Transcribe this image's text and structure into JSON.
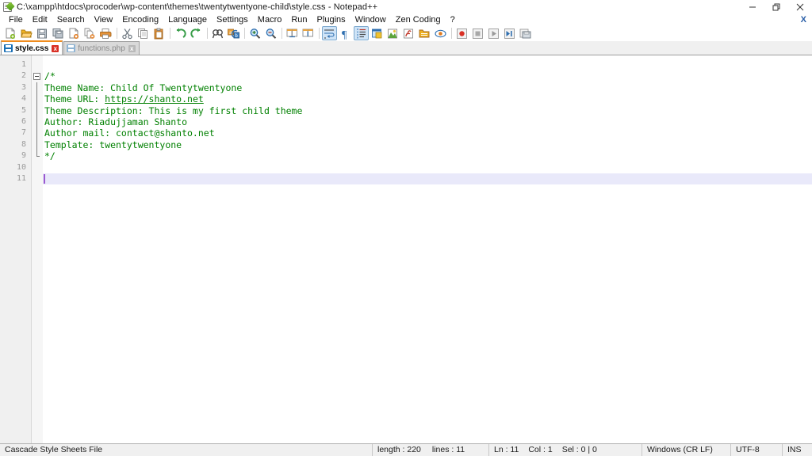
{
  "window": {
    "title": "C:\\xampp\\htdocs\\procoder\\wp-content\\themes\\twentytwentyone-child\\style.css - Notepad++",
    "icon": "notepad-plus-plus-icon",
    "controls": {
      "minimize": "minimize-icon",
      "restore": "restore-icon",
      "close": "close-icon"
    }
  },
  "menubar": {
    "items": [
      {
        "label": "File"
      },
      {
        "label": "Edit"
      },
      {
        "label": "Search"
      },
      {
        "label": "View"
      },
      {
        "label": "Encoding"
      },
      {
        "label": "Language"
      },
      {
        "label": "Settings"
      },
      {
        "label": "Macro"
      },
      {
        "label": "Run"
      },
      {
        "label": "Plugins"
      },
      {
        "label": "Window"
      },
      {
        "label": "Zen Coding"
      },
      {
        "label": "?"
      }
    ],
    "doc_close_label": "X"
  },
  "toolbar": {
    "buttons": [
      {
        "name": "new-file-icon",
        "group": 1
      },
      {
        "name": "open-file-icon",
        "group": 1
      },
      {
        "name": "save-icon",
        "group": 1
      },
      {
        "name": "save-all-icon",
        "group": 1
      },
      {
        "name": "close-file-icon",
        "group": 1
      },
      {
        "name": "close-all-files-icon",
        "group": 1
      },
      {
        "name": "print-icon",
        "group": 1
      },
      {
        "name": "cut-icon",
        "group": 2
      },
      {
        "name": "copy-icon",
        "group": 2
      },
      {
        "name": "paste-icon",
        "group": 2
      },
      {
        "name": "undo-icon",
        "group": 3
      },
      {
        "name": "redo-icon",
        "group": 3
      },
      {
        "name": "find-icon",
        "group": 4
      },
      {
        "name": "replace-icon",
        "group": 4
      },
      {
        "name": "zoom-in-icon",
        "group": 5
      },
      {
        "name": "zoom-out-icon",
        "group": 5
      },
      {
        "name": "sync-vertical-scroll-icon",
        "group": 6
      },
      {
        "name": "sync-horizontal-scroll-icon",
        "group": 6
      },
      {
        "name": "word-wrap-icon",
        "group": 7,
        "active": true
      },
      {
        "name": "show-all-characters-icon",
        "group": 7
      },
      {
        "name": "indent-guide-icon",
        "group": 7,
        "active": true
      },
      {
        "name": "user-defined-dialog-icon",
        "group": 7
      },
      {
        "name": "document-map-icon",
        "group": 7
      },
      {
        "name": "function-list-icon",
        "group": 7
      },
      {
        "name": "folder-as-workspace-icon",
        "group": 7
      },
      {
        "name": "monitoring-icon",
        "group": 7
      },
      {
        "name": "record-macro-icon",
        "group": 8
      },
      {
        "name": "stop-recording-icon",
        "group": 8
      },
      {
        "name": "play-macro-icon",
        "group": 8
      },
      {
        "name": "run-macro-multiple-icon",
        "group": 8
      },
      {
        "name": "save-macro-icon",
        "group": 8
      }
    ]
  },
  "tabs": [
    {
      "label": "style.css",
      "active": true,
      "icon": "saved-file-icon",
      "close": "x"
    },
    {
      "label": "functions.php",
      "active": false,
      "icon": "saved-file-icon",
      "close": "x"
    }
  ],
  "editor": {
    "line_numbers": [
      "1",
      "2",
      "3",
      "4",
      "5",
      "6",
      "7",
      "8",
      "9",
      "10",
      "11"
    ],
    "current_line": 11,
    "comment_color": "#008000",
    "current_line_bg": "#e9e9fa",
    "caret_color": "#9b59d0",
    "lines": [
      {
        "n": 1,
        "text": "",
        "fold": "none"
      },
      {
        "n": 2,
        "text": "/*",
        "fold": "start"
      },
      {
        "n": 3,
        "text": "Theme Name: Child Of Twentytwentyone",
        "fold": "body"
      },
      {
        "n": 4,
        "pre": "Theme URL: ",
        "link": "https://shanto.net",
        "text": "Theme URL: https://shanto.net",
        "fold": "body"
      },
      {
        "n": 5,
        "text": "Theme Description: This is my first child theme",
        "fold": "body"
      },
      {
        "n": 6,
        "text": "Author: Riadujjaman Shanto",
        "fold": "body"
      },
      {
        "n": 7,
        "text": "Author mail: contact@shanto.net",
        "fold": "body"
      },
      {
        "n": 8,
        "text": "Template: twentytwentyone",
        "fold": "body"
      },
      {
        "n": 9,
        "text": "*/",
        "fold": "end"
      },
      {
        "n": 10,
        "text": "",
        "fold": "none"
      },
      {
        "n": 11,
        "text": "",
        "fold": "none"
      }
    ]
  },
  "statusbar": {
    "doc_type": "Cascade Style Sheets File",
    "length_label": "length : 220",
    "lines_label": "lines : 11",
    "ln": "Ln : 11",
    "col": "Col : 1",
    "sel": "Sel : 0 | 0",
    "eol": "Windows (CR LF)",
    "encoding": "UTF-8",
    "insert_mode": "INS"
  }
}
